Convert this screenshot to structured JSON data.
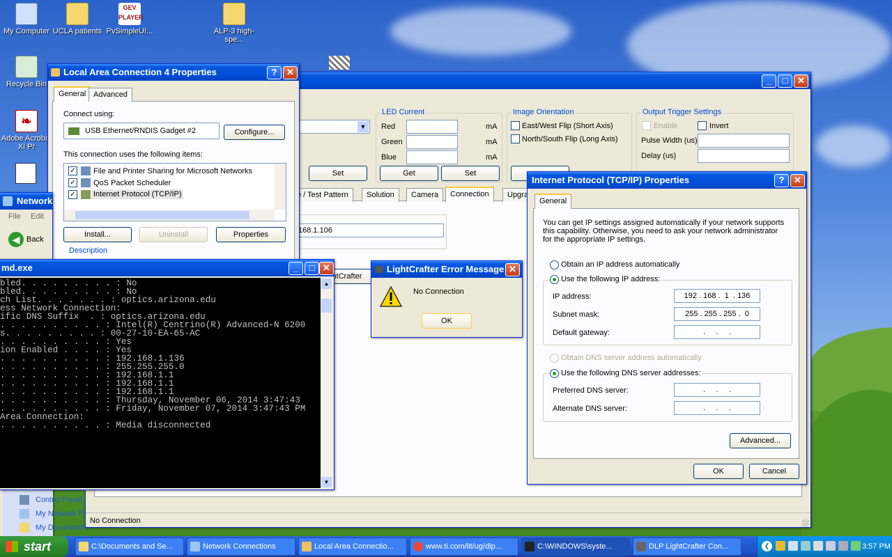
{
  "desktop": {
    "icons": [
      {
        "label": "My Computer",
        "color": "#cfe0f8"
      },
      {
        "label": "UCLA patients",
        "color": "#f5d76e"
      },
      {
        "label": "PvSimpleUI...",
        "color": "#a01010"
      },
      {
        "label": "ALP-3 high-spe...",
        "color": "#f5d76e"
      },
      {
        "label": "Recycle Bin",
        "color": "#d8ecd8"
      },
      {
        "label": "Adobe Acrobat XI Pr",
        "color": "#ffffff"
      }
    ],
    "gev_text": "GEV PLAYER"
  },
  "lan": {
    "title": "Local Area Connection 4 Properties",
    "tabs": [
      "General",
      "Advanced"
    ],
    "connect_using": "Connect using:",
    "adapter": "USB Ethernet/RNDIS Gadget #2",
    "configure": "Configure...",
    "items_label": "This connection uses the following items:",
    "items": [
      "File and Printer Sharing for Microsoft Networks",
      "QoS Packet Scheduler",
      "Internet Protocol (TCP/IP)"
    ],
    "install": "Install...",
    "uninstall": "Uninstall",
    "properties": "Properties",
    "description": "Description"
  },
  "lc": {
    "led": {
      "title": "LED Current",
      "red": "Red",
      "green": "Green",
      "blue": "Blue",
      "unit": "mA",
      "get": "Get",
      "set": "Set"
    },
    "set_left": "Set",
    "orient": {
      "title": "Image Orientation",
      "ew": "East/West Flip (Short Axis)",
      "ns": "North/South Flip (Long Axis)"
    },
    "trigger": {
      "title": "Output Trigger Settings",
      "enable": "Enable",
      "invert": "Invert",
      "pulse": "Pulse Width (us)",
      "delay": "Delay (us)"
    },
    "tabs": [
      "e / Test Pattern",
      "Solution",
      "Camera",
      "Connection",
      "Upgra"
    ],
    "ip_value": "168.1.106",
    "btn_partial": "ightCrafter",
    "status": "No Connection"
  },
  "net": {
    "title": "Network",
    "menu_file": "File",
    "menu_edit": "Edit",
    "back": "Back",
    "links": [
      "Control Panel",
      "My Network Pl",
      "My Documents"
    ]
  },
  "cmd": {
    "title": "md.exe",
    "lines": [
      "bled. . . . . . . . . : No",
      "bled. . . . . . . . . : No",
      "ch List. . . . . . . : optics.arizona.edu",
      "",
      "ess Network Connection:",
      "",
      "ific DNS Suffix  . : optics.arizona.edu",
      ". . . . . . . . . . : Intel(R) Centrino(R) Advanced-N 6200",
      "",
      "s. . . . . . . . . : 00-27-10-EA-65-AC",
      ". . . . . . . . . . : Yes",
      "ion Enabled . . . . : Yes",
      ". . . . . . . . . . : 192.168.1.136",
      ". . . . . . . . . . : 255.255.255.0",
      ". . . . . . . . . . : 192.168.1.1",
      ". . . . . . . . . . : 192.168.1.1",
      ". . . . . . . . . . : 192.168.1.1",
      ". . . . . . . . . . : Thursday, November 06, 2014 3:47:43",
      "",
      ". . . . . . . . . . : Friday, November 07, 2014 3:47:43 PM",
      "",
      "",
      "Area Connection:",
      "",
      ". . . . . . . . . . : Media disconnected"
    ]
  },
  "err": {
    "title": "LightCrafter Error Message",
    "message": "No Connection",
    "ok": "OK"
  },
  "tcp": {
    "title": "Internet Protocol (TCP/IP) Properties",
    "tab": "General",
    "intro": "You can get IP settings assigned automatically if your network supports this capability. Otherwise, you need to ask your network administrator for the appropriate IP settings.",
    "auto_ip": "Obtain an IP address automatically",
    "use_ip": "Use the following IP address:",
    "ip_label": "IP address:",
    "ip": [
      "192",
      "168",
      "1",
      "136"
    ],
    "mask_label": "Subnet mask:",
    "mask": [
      "255",
      "255",
      "255",
      "0"
    ],
    "gw_label": "Default gateway:",
    "auto_dns": "Obtain DNS server address automatically",
    "use_dns": "Use the following DNS server addresses:",
    "pref_dns": "Preferred DNS server:",
    "alt_dns": "Alternate DNS server:",
    "advanced": "Advanced...",
    "ok": "OK",
    "cancel": "Cancel"
  },
  "taskbar": {
    "start": "start",
    "clock": "3:57 PM",
    "tasks": [
      {
        "label": "C:\\Documents and Se...",
        "color": "#f5d76e"
      },
      {
        "label": "Network Connections",
        "color": "#9ec5f0"
      },
      {
        "label": "Local Area Connectio...",
        "color": "#f0c060"
      },
      {
        "label": "www.ti.com/lit/ug/dlp...",
        "color": "#e8483a"
      },
      {
        "label": "C:\\WINDOWS\\syste...",
        "color": "#222222"
      },
      {
        "label": "DLP LightCrafter Con...",
        "color": "#666666"
      }
    ]
  }
}
